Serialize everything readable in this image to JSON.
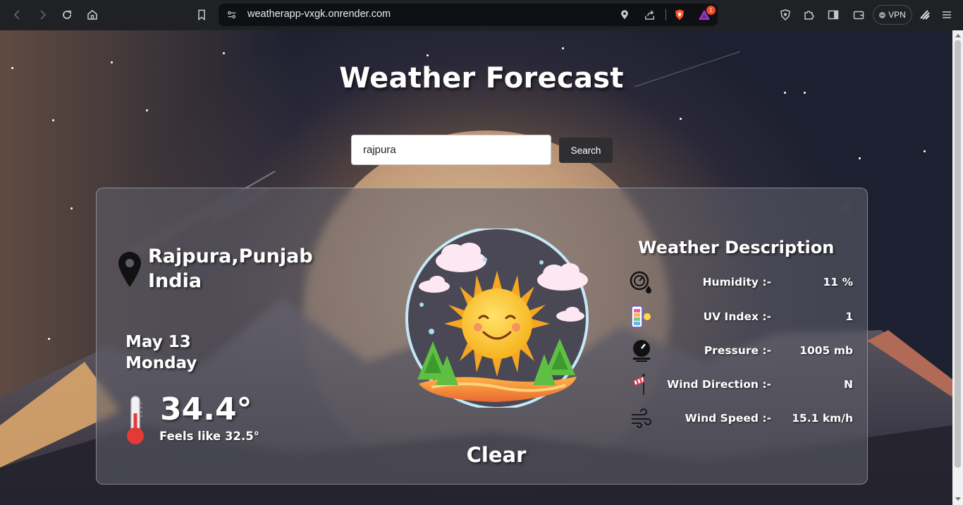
{
  "browser": {
    "url": "weatherapp-vxgk.onrender.com",
    "notification_count": "1",
    "vpn_label": "VPN"
  },
  "header": {
    "title": "Weather Forecast"
  },
  "search": {
    "value": "rajpura",
    "button_label": "Search"
  },
  "location": {
    "city_state": "Rajpura,Punjab",
    "country": "India"
  },
  "date": {
    "day_month": "May 13",
    "weekday": "Monday"
  },
  "temperature": {
    "current": "34.4°",
    "feels_like": "Feels like 32.5°"
  },
  "condition": "Clear",
  "description": {
    "title": "Weather Description",
    "rows": [
      {
        "icon": "humidity-icon",
        "label": "Humidity :-",
        "value": "11 %"
      },
      {
        "icon": "uv-index-icon",
        "label": "UV Index :-",
        "value": "1"
      },
      {
        "icon": "pressure-icon",
        "label": "Pressure :-",
        "value": "1005 mb"
      },
      {
        "icon": "wind-direction-icon",
        "label": "Wind Direction :-",
        "value": "N"
      },
      {
        "icon": "wind-speed-icon",
        "label": "Wind Speed :-",
        "value": "15.1 km/h"
      }
    ]
  },
  "colors": {
    "chrome_bg": "#202124",
    "search_button_bg": "#2f2f31",
    "thermometer_red": "#e53935"
  }
}
